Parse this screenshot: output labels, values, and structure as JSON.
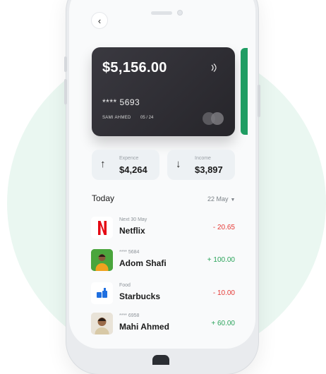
{
  "card": {
    "balance": "$5,156.00",
    "number": "**** 5693",
    "holder": "SAMI AHMED",
    "expiry": "05 / 24"
  },
  "stats": {
    "expense": {
      "label": "Expence",
      "value": "$4,264"
    },
    "income": {
      "label": "Income",
      "value": "$3,897"
    }
  },
  "section": {
    "title": "Today",
    "date": "22 May"
  },
  "transactions": [
    {
      "subtitle": "Next 30 May",
      "name": "Netflix",
      "amount": "- 20.65",
      "type": "debit",
      "icon": "netflix-logo-icon"
    },
    {
      "subtitle": "**** 5684",
      "name": "Adom Shafi",
      "amount": "+ 100.00",
      "type": "credit",
      "icon": "avatar"
    },
    {
      "subtitle": "Food",
      "name": "Starbucks",
      "amount": "- 10.00",
      "type": "debit",
      "icon": "coffee-cup-icon"
    },
    {
      "subtitle": "**** 6958",
      "name": "Mahi Ahmed",
      "amount": "+ 60.00",
      "type": "credit",
      "icon": "avatar"
    }
  ],
  "colors": {
    "accent_green": "#1f9d63",
    "card_dark": "#2e2d33",
    "negative": "#e53935",
    "positive": "#2aa35a",
    "background_circle": "#eaf7f1"
  }
}
